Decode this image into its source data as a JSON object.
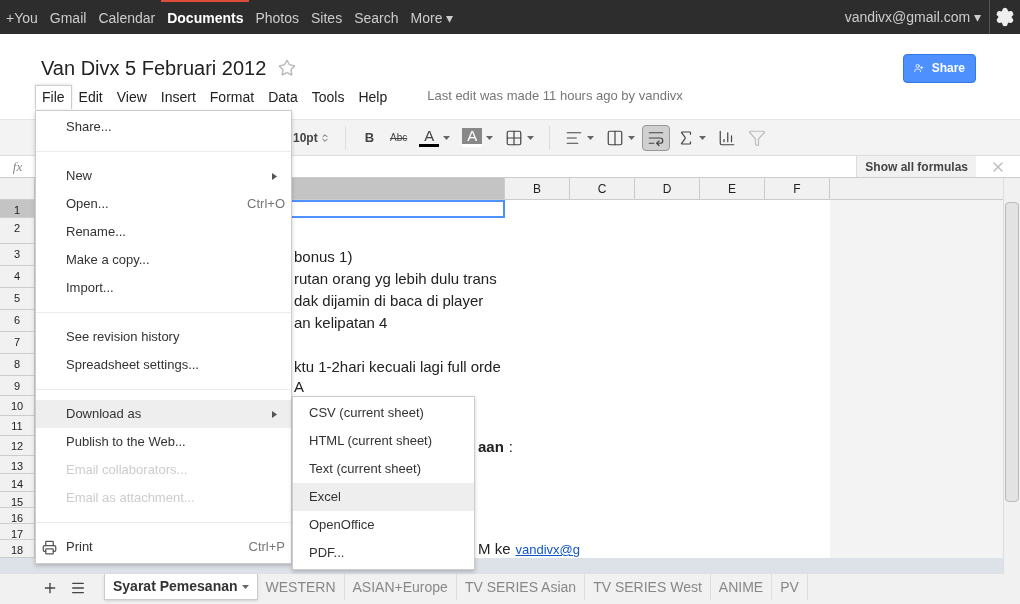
{
  "topbar": {
    "items": [
      {
        "label": "+You",
        "selected": false
      },
      {
        "label": "Gmail",
        "selected": false
      },
      {
        "label": "Calendar",
        "selected": false
      },
      {
        "label": "Documents",
        "selected": true
      },
      {
        "label": "Photos",
        "selected": false
      },
      {
        "label": "Sites",
        "selected": false
      },
      {
        "label": "Search",
        "selected": false
      },
      {
        "label": "More ▾",
        "selected": false
      }
    ],
    "account": "vandivx@gmail.com ▾"
  },
  "document": {
    "title": "Van Divx 5 Februari 2012",
    "starred": false,
    "share": "Share",
    "last_edit": "Last edit was made 11 hours ago by vandivx"
  },
  "menubar": [
    {
      "label": "File",
      "selected": true
    },
    {
      "label": "Edit",
      "selected": false
    },
    {
      "label": "View",
      "selected": false
    },
    {
      "label": "Insert",
      "selected": false
    },
    {
      "label": "Format",
      "selected": false
    },
    {
      "label": "Data",
      "selected": false
    },
    {
      "label": "Tools",
      "selected": false
    },
    {
      "label": "Help",
      "selected": false
    }
  ],
  "toolbar": [
    {
      "kind": "fontsize",
      "label": "10pt",
      "pressed": false,
      "disabled": false
    },
    {
      "kind": "sep"
    },
    {
      "kind": "bold",
      "label": "B",
      "pressed": false,
      "disabled": false
    },
    {
      "kind": "strike",
      "label": "Abc",
      "pressed": false,
      "disabled": false
    },
    {
      "kind": "textcolor",
      "label": "A",
      "pressed": false,
      "disabled": false
    },
    {
      "kind": "fillcolor",
      "label": "A",
      "pressed": false,
      "disabled": false
    },
    {
      "kind": "borders",
      "pressed": false,
      "disabled": false
    },
    {
      "kind": "sep"
    },
    {
      "kind": "align",
      "pressed": false,
      "disabled": false
    },
    {
      "kind": "merge",
      "pressed": false,
      "disabled": false
    },
    {
      "kind": "wrap",
      "pressed": true,
      "disabled": false
    },
    {
      "kind": "sum",
      "pressed": false,
      "disabled": false
    },
    {
      "kind": "chart",
      "pressed": false,
      "disabled": false
    },
    {
      "kind": "filter",
      "pressed": false,
      "disabled": true
    }
  ],
  "formula_bar": {
    "label": "fx",
    "button": "Show all formulas"
  },
  "column_a": {
    "selected": true
  },
  "columns": [
    {
      "label": "B"
    },
    {
      "label": "C"
    },
    {
      "label": "D"
    },
    {
      "label": "E"
    },
    {
      "label": "F"
    }
  ],
  "rows": [
    {
      "number": "1",
      "selected": true
    },
    {
      "number": "2",
      "selected": false
    },
    {
      "number": "3",
      "selected": false,
      "parts": [
        {
          "text": "bonus 1)",
          "bold": false,
          "link": false
        }
      ]
    },
    {
      "number": "4",
      "selected": false,
      "parts": [
        {
          "text": "rutan orang yg lebih dulu trans",
          "bold": false,
          "link": false
        }
      ]
    },
    {
      "number": "5",
      "selected": false,
      "parts": [
        {
          "text": "dak dijamin di baca di player",
          "bold": false,
          "link": false
        }
      ]
    },
    {
      "number": "6",
      "selected": false,
      "parts": [
        {
          "text": "an kelipatan 4",
          "bold": false,
          "link": false
        }
      ]
    },
    {
      "number": "7",
      "selected": false
    },
    {
      "number": "8",
      "selected": false,
      "parts": [
        {
          "text": "ktu 1-2hari kecuali lagi full orde",
          "bold": false,
          "link": false
        }
      ]
    },
    {
      "number": "9",
      "selected": false,
      "parts": [
        {
          "text": "A",
          "bold": false,
          "link": false
        }
      ]
    },
    {
      "number": "10",
      "selected": false
    },
    {
      "number": "11",
      "selected": false
    },
    {
      "number": "12",
      "selected": false,
      "parts": [
        {
          "text": "aan",
          "bold": true,
          "link": false
        },
        {
          "text": ":",
          "bold": false,
          "link": false
        }
      ]
    },
    {
      "number": "13",
      "selected": false
    },
    {
      "number": "14",
      "selected": false
    },
    {
      "number": "15",
      "selected": false
    },
    {
      "number": "16",
      "selected": false
    },
    {
      "number": "17",
      "selected": false
    },
    {
      "number": "18",
      "selected": false,
      "parts": [
        {
          "text": "M ke",
          "bold": false,
          "link": false
        },
        {
          "text": "vandivx@g",
          "bold": false,
          "link": true
        }
      ]
    }
  ],
  "sheet_tabs": [
    {
      "label": "Syarat Pemesanan",
      "selected": true
    },
    {
      "label": "WESTERN",
      "selected": false
    },
    {
      "label": "ASIAN+Europe",
      "selected": false
    },
    {
      "label": "TV SERIES Asian",
      "selected": false
    },
    {
      "label": "TV SERIES West",
      "selected": false
    },
    {
      "label": "ANIME",
      "selected": false
    },
    {
      "label": "PV",
      "selected": false
    }
  ],
  "file_menu": [
    {
      "kind": "item",
      "label": "Share...",
      "disabled": false,
      "selected": false
    },
    {
      "kind": "separator"
    },
    {
      "kind": "submenu",
      "label": "New",
      "disabled": false,
      "selected": false
    },
    {
      "kind": "item",
      "label": "Open...",
      "shortcut": "Ctrl+O",
      "disabled": false,
      "selected": false
    },
    {
      "kind": "item",
      "label": "Rename...",
      "disabled": false,
      "selected": false
    },
    {
      "kind": "item",
      "label": "Make a copy...",
      "disabled": false,
      "selected": false
    },
    {
      "kind": "item",
      "label": "Import...",
      "disabled": false,
      "selected": false
    },
    {
      "kind": "separator"
    },
    {
      "kind": "item",
      "label": "See revision history",
      "disabled": false,
      "selected": false
    },
    {
      "kind": "item",
      "label": "Spreadsheet settings...",
      "disabled": false,
      "selected": false
    },
    {
      "kind": "separator"
    },
    {
      "kind": "submenu",
      "label": "Download as",
      "disabled": false,
      "selected": true
    },
    {
      "kind": "item",
      "label": "Publish to the Web...",
      "disabled": false,
      "selected": false
    },
    {
      "kind": "item",
      "label": "Email collaborators...",
      "disabled": true,
      "selected": false
    },
    {
      "kind": "item",
      "label": "Email as attachment...",
      "disabled": true,
      "selected": false
    },
    {
      "kind": "separator"
    },
    {
      "kind": "print",
      "label": "Print",
      "shortcut": "Ctrl+P",
      "disabled": false,
      "selected": false
    }
  ],
  "download_submenu": [
    {
      "label": "CSV (current sheet)",
      "selected": false
    },
    {
      "label": "HTML (current sheet)",
      "selected": false
    },
    {
      "label": "Text (current sheet)",
      "selected": false
    },
    {
      "label": "Excel",
      "selected": true
    },
    {
      "label": "OpenOffice",
      "selected": false
    },
    {
      "label": "PDF...",
      "selected": false
    }
  ]
}
